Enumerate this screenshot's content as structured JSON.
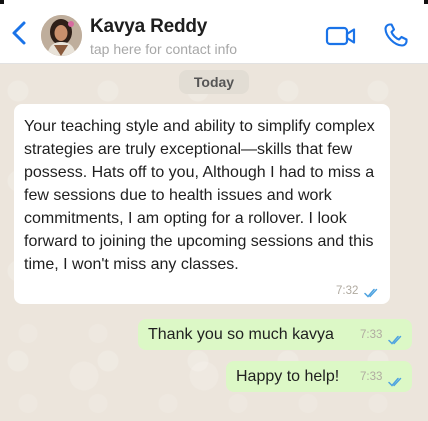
{
  "header": {
    "contact_name": "Kavya Reddy",
    "subtitle": "tap here for contact info",
    "icons": [
      "chevron-left-icon",
      "avatar",
      "video-camera-icon",
      "phone-icon"
    ],
    "accent_color": "#1a73e8"
  },
  "chat": {
    "date_label": "Today",
    "messages": [
      {
        "direction": "incoming",
        "text": "Your teaching style and ability to simplify complex strategies are truly exceptional—skills that few possess. Hats off to you, Although I had to miss a few sessions due to health issues and work commitments, I am opting for a rollover. I look forward to joining the upcoming sessions and this time, I won't miss any classes.",
        "time": "7:32",
        "status": "read"
      },
      {
        "direction": "outgoing",
        "text": "Thank you so much kavya",
        "time": "7:33",
        "status": "read"
      },
      {
        "direction": "outgoing",
        "text": "Happy to help!",
        "time": "7:33",
        "status": "read"
      }
    ],
    "colors": {
      "incoming_bubble": "#ffffff",
      "outgoing_bubble": "#dcf8c6",
      "read_ticks": "#4fa3e0"
    }
  }
}
